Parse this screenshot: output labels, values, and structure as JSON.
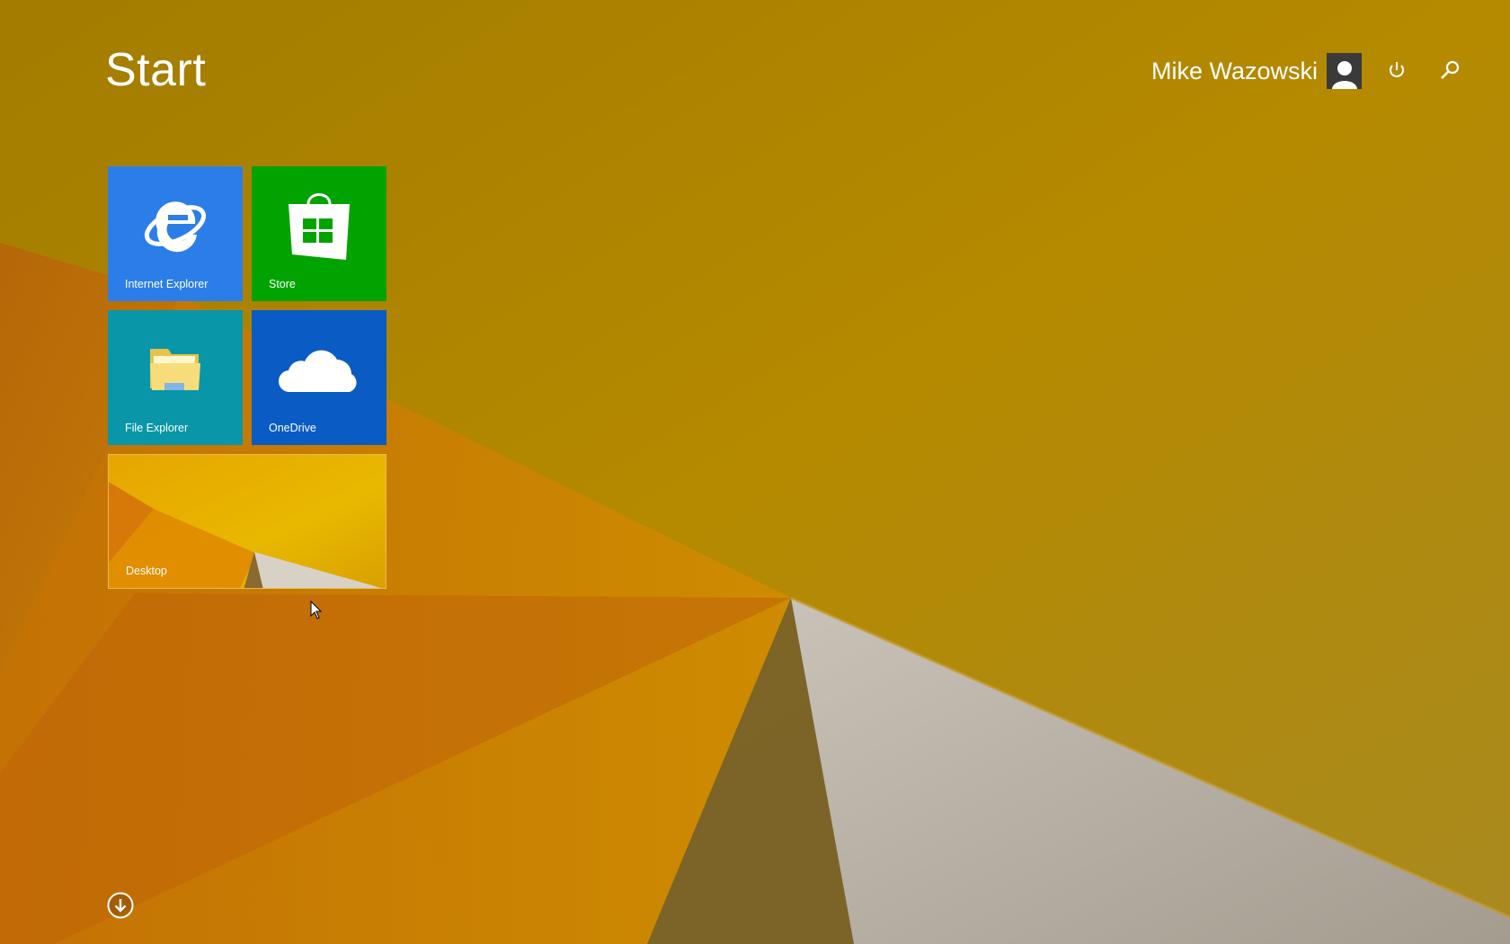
{
  "screen": {
    "title": "Start"
  },
  "user": {
    "name": "Mike Wazowski"
  },
  "tiles": [
    {
      "id": "internet-explorer",
      "label": "Internet Explorer",
      "color": "#2b7ee8"
    },
    {
      "id": "store",
      "label": "Store",
      "color": "#00a300"
    },
    {
      "id": "file-explorer",
      "label": "File Explorer",
      "color": "#0896a8"
    },
    {
      "id": "onedrive",
      "label": "OneDrive",
      "color": "#0a5bc4"
    },
    {
      "id": "desktop",
      "label": "Desktop",
      "color": "#d9a100"
    }
  ],
  "icons": {
    "power": "power-icon",
    "search": "search-icon",
    "all_apps": "down-arrow-circle-icon"
  }
}
